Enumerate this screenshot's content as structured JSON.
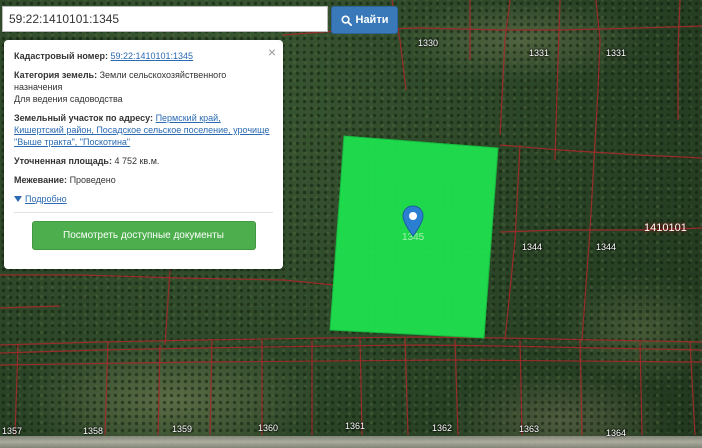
{
  "search": {
    "value": "59:22:1410101:1345",
    "button_label": "Найти"
  },
  "info": {
    "cadastral_label": "Кадастровый номер:",
    "cadastral_value": "59:22:1410101:1345",
    "category_label": "Категория земель:",
    "category_value": "Земли сельскохозяйственного назначения",
    "usage_value": "Для ведения садоводства",
    "address_label": "Земельный участок по адресу:",
    "address_value": "Пермский край, Кишертский район, Посадское сельское поселение, урочище \"Выше тракта\", \"Поскотина\"",
    "area_label": "Уточненная площадь:",
    "area_value": "4 752 кв.м.",
    "survey_label": "Межевание:",
    "survey_value": "Проведено",
    "details_label": "Подробно",
    "docs_button": "Посмотреть доступные документы",
    "close_symbol": "×"
  },
  "map": {
    "quarter_number": "1410101",
    "plot_short_label": "1345",
    "parcel_labels": [
      "1330",
      "1331",
      "1331",
      "1344",
      "1344",
      "1357",
      "1358",
      "1359",
      "1360",
      "1361",
      "1362",
      "1363",
      "1364"
    ]
  },
  "colors": {
    "plot_fill": "#1fe04e",
    "boundary": "#a02b2b",
    "search_button": "#3a79b9",
    "docs_button": "#4cae4c",
    "link": "#2a6ab2"
  },
  "icons": {
    "search": "search-icon",
    "pin": "map-marker-icon",
    "close": "close-icon",
    "expand": "caret-down-icon"
  }
}
